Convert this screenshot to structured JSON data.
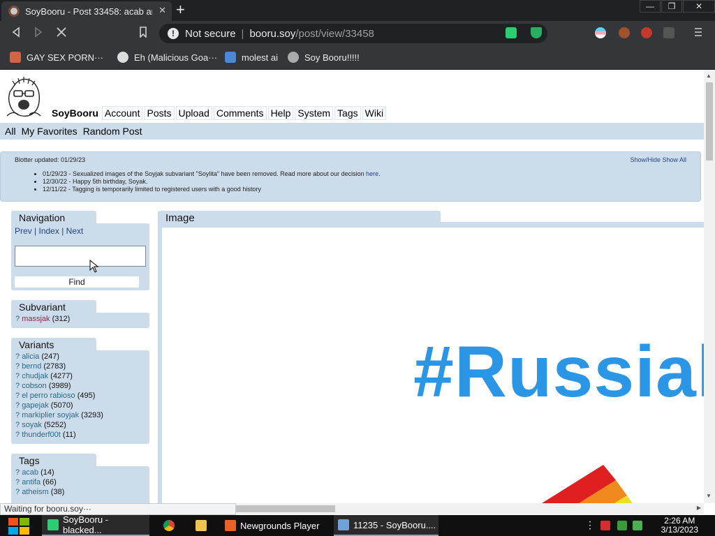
{
  "browser": {
    "tab_title": "SoyBooru - Post 33458: acab an",
    "tab_close": "✕",
    "new_tab": "+",
    "window_buttons": [
      "—",
      "❐",
      "✕"
    ],
    "omnibox": {
      "security": "Not secure",
      "host": "booru.soy",
      "path": "/post/view/33458"
    },
    "bookmarks": [
      {
        "label": "GAY SEX PORN···",
        "icon_color": "#cc6644"
      },
      {
        "label": "Eh (Malicious Goa···",
        "icon_color": "#dddddd"
      },
      {
        "label": "molest ai",
        "icon_color": "#4a8ad4"
      },
      {
        "label": "Soy Booru!!!!!",
        "icon_color": "#aaaaaa"
      }
    ]
  },
  "site": {
    "brand": "SoyBooru",
    "nav": [
      "Account",
      "Posts",
      "Upload",
      "Comments",
      "Help",
      "System",
      "Tags",
      "Wiki"
    ],
    "subnav": [
      "All",
      "My Favorites",
      "Random Post"
    ]
  },
  "blotter": {
    "updated": "Blotter updated: 01/29/23",
    "toggle": "Show/Hide Show All",
    "entries": [
      {
        "text": "01/29/23 - Sexualized images of the Soyjak subvariant \"Soylita\" have been removed. Read more about our decision ",
        "link": "here",
        "tail": "."
      },
      {
        "text": "12/30/22 - Happy 5th birthday, Soyak.",
        "link": "",
        "tail": ""
      },
      {
        "text": "12/11/22 - Tagging is temporarily limited to registered users with a good history",
        "link": "",
        "tail": ""
      }
    ]
  },
  "navigation": {
    "header": "Navigation",
    "prev": "Prev",
    "index": "Index",
    "next": "Next",
    "sep": "|",
    "search_value": "",
    "find_label": "Find"
  },
  "subvariant": {
    "header": "Subvariant",
    "items": [
      {
        "name": "massjak",
        "count": "(312)"
      }
    ]
  },
  "variants": {
    "header": "Variants",
    "items": [
      {
        "name": "alicia",
        "count": "(247)"
      },
      {
        "name": "bernd",
        "count": "(2783)"
      },
      {
        "name": "chudjak",
        "count": "(4277)"
      },
      {
        "name": "cobson",
        "count": "(3989)"
      },
      {
        "name": "el perro rabioso",
        "count": "(495)"
      },
      {
        "name": "gapejak",
        "count": "(5070)"
      },
      {
        "name": "markiplier soyjak",
        "count": "(3293)"
      },
      {
        "name": "soyak",
        "count": "(5252)"
      },
      {
        "name": "thunderf00t",
        "count": "(11)"
      }
    ]
  },
  "tags": {
    "header": "Tags",
    "items": [
      {
        "name": "acab",
        "count": "(14)"
      },
      {
        "name": "antifa",
        "count": "(66)"
      },
      {
        "name": "atheism",
        "count": "(38)"
      }
    ]
  },
  "image_panel": {
    "header": "Image",
    "image_text": "#Russials"
  },
  "status_text": "Waiting for booru.soy···",
  "taskbar": {
    "items": [
      {
        "label": "SoyBooru - blacked...",
        "icon_color": "#2ecc71"
      },
      {
        "label": "",
        "icon_color": "#e8b32f"
      },
      {
        "label": "",
        "icon_color": "#f0c64a"
      },
      {
        "label": "Newgrounds Player",
        "icon_color": "#e8622a"
      },
      {
        "label": "11235 - SoyBooru....",
        "icon_color": "#6fa3d8"
      }
    ],
    "time": "2:26 AM",
    "date": "3/13/2023"
  }
}
